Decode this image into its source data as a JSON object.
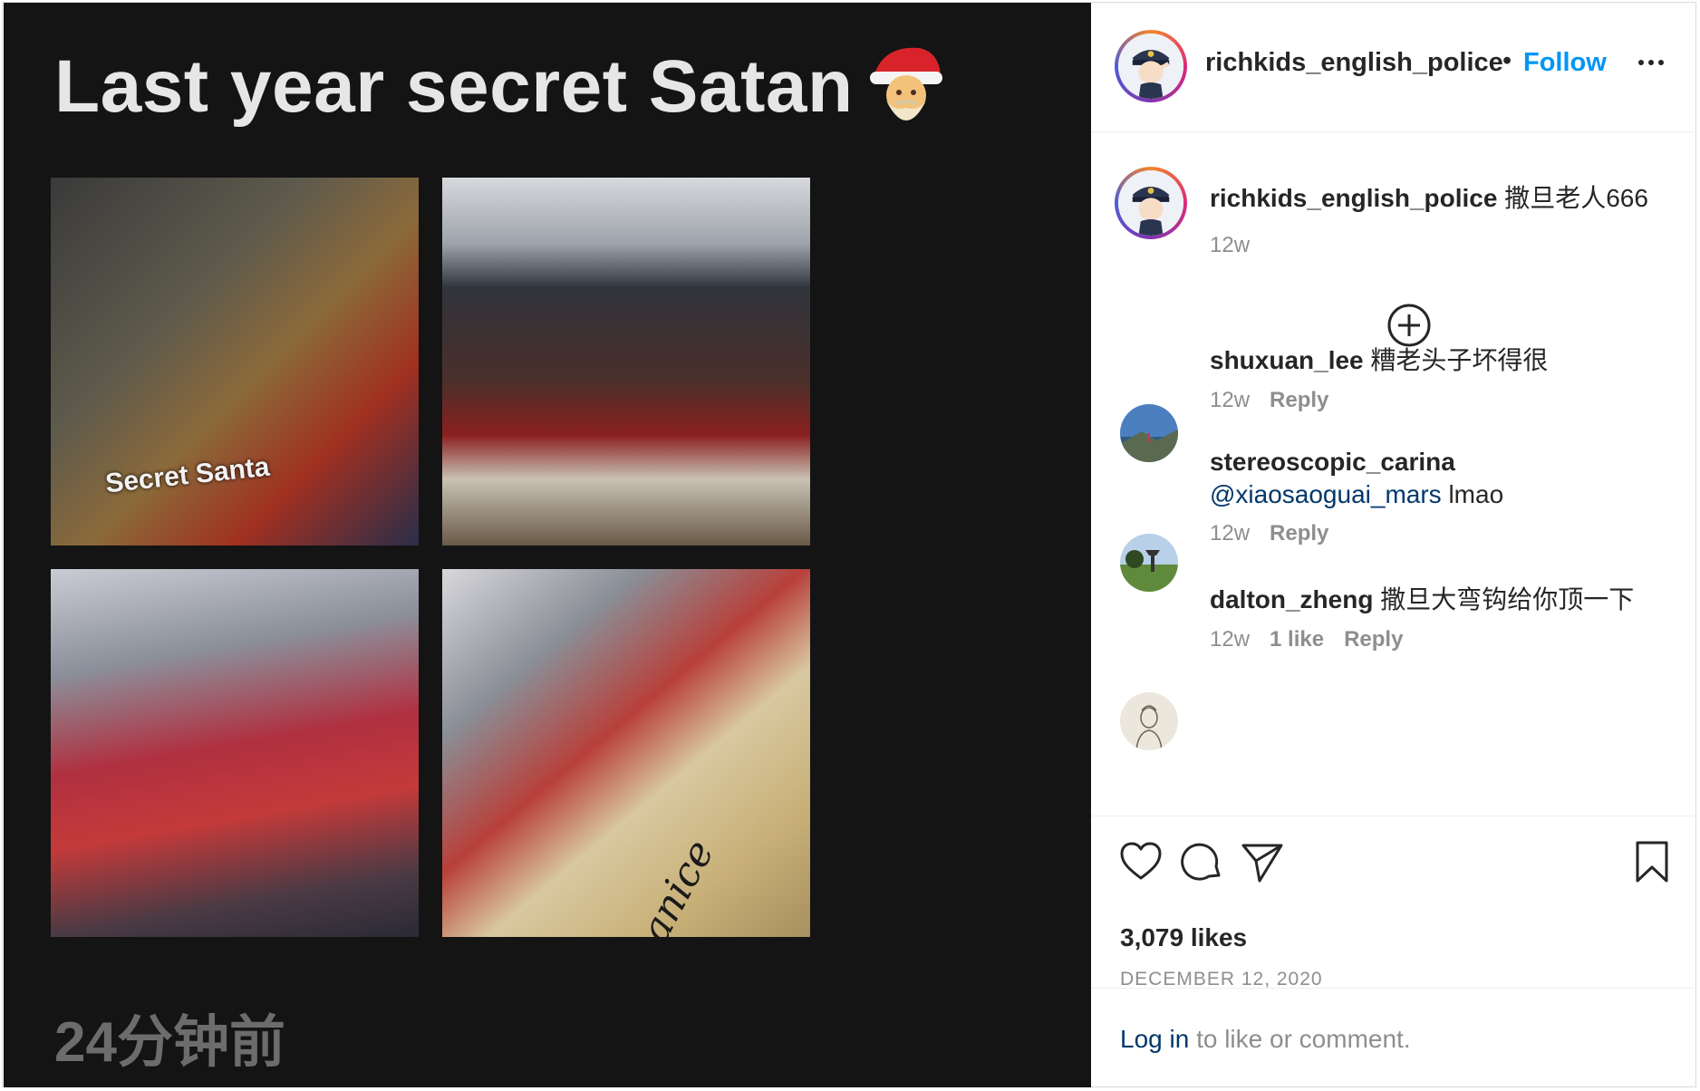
{
  "post": {
    "image_title": "Last year secret Satan",
    "photo_caption_1": "Secret Santa",
    "photo_caption_2": "anice",
    "image_timestamp": "24分钟前"
  },
  "header": {
    "username": "richkids_english_police",
    "separator": "•",
    "follow_label": "Follow"
  },
  "caption": {
    "username": "richkids_english_police",
    "text": "撒旦老人666",
    "time": "12w"
  },
  "comments": [
    {
      "username": "shuxuan_lee",
      "text": "糟老头子坏得很",
      "time": "12w",
      "reply": "Reply"
    },
    {
      "username": "stereoscopic_carina",
      "mention": "@xiaosaoguai_mars",
      "text": " lmao",
      "time": "12w",
      "reply": "Reply"
    },
    {
      "username": "dalton_zheng",
      "text": "撒旦大弯钩给你顶一下",
      "time": "12w",
      "likes": "1 like",
      "reply": "Reply"
    }
  ],
  "stats": {
    "likes": "3,079 likes",
    "date": "DECEMBER 12, 2020"
  },
  "login": {
    "link": "Log in",
    "text": " to like or comment."
  },
  "icons": [
    "santa-emoji-icon",
    "more-options-icon",
    "add-circle-icon",
    "heart-icon",
    "comment-icon",
    "share-icon",
    "bookmark-icon"
  ],
  "colors": {
    "accent": "#0095f6",
    "text": "#262626",
    "muted": "#8e8e8e",
    "image_bg": "#141414"
  }
}
